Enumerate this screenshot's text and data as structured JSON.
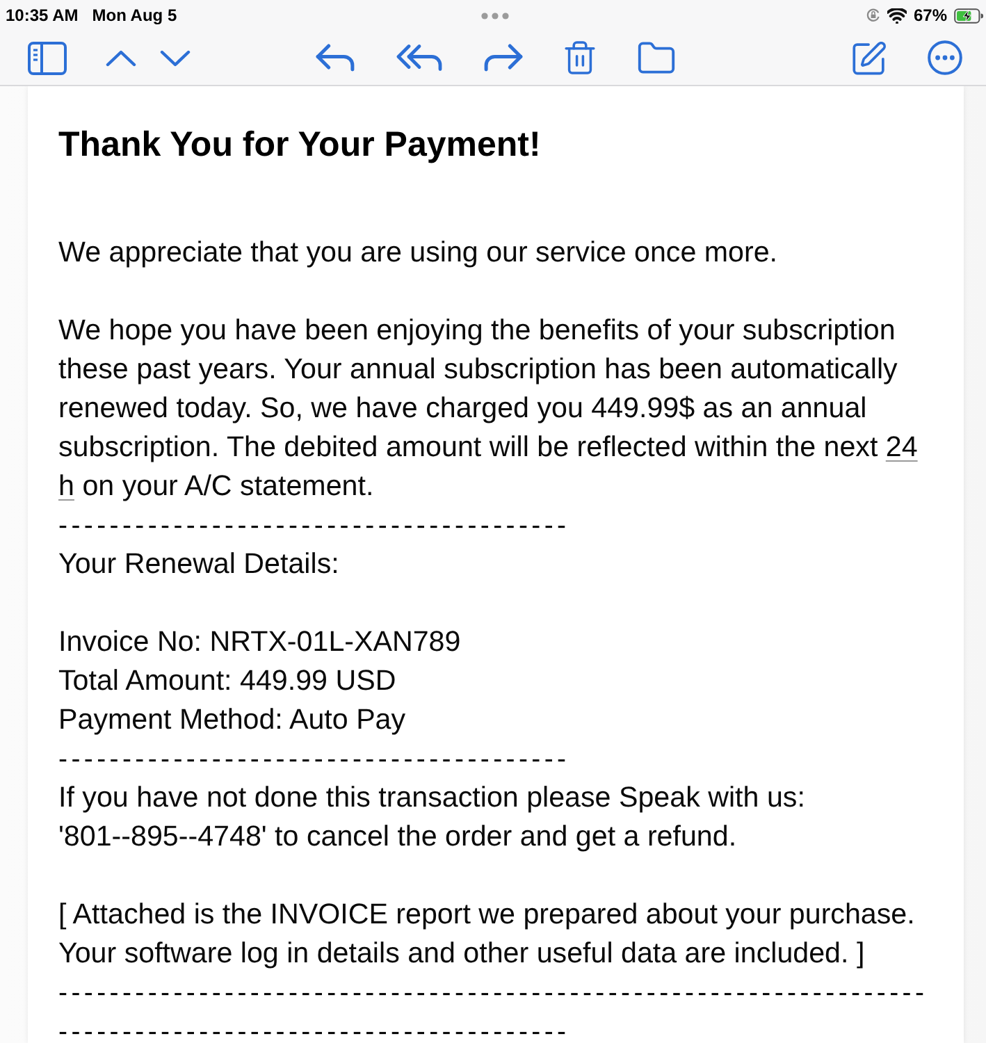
{
  "status_bar": {
    "time": "10:35 AM",
    "date": "Mon Aug 5",
    "battery": "67%",
    "charging": true
  },
  "email": {
    "title": "Thank You for Your Payment!",
    "blocks": [
      {
        "kind": "paragraph",
        "lines": [
          [
            {
              "text": "We appreciate that you are using our service once more.",
              "underlined": false
            }
          ]
        ]
      },
      {
        "kind": "paragraph",
        "lines": [
          [
            {
              "text": "We hope you have been enjoying the benefits of your subscription",
              "underlined": false
            }
          ],
          [
            {
              "text": "these past years. Your annual subscription has been automatically",
              "underlined": false
            }
          ],
          [
            {
              "text": "renewed today. So, we have charged you 449.99$ as an annual",
              "underlined": false
            }
          ],
          [
            {
              "text": "subscription. The debited amount will be reflected within the next ",
              "underlined": false
            },
            {
              "text": "24",
              "underlined": true
            }
          ],
          [
            {
              "text": "h",
              "underlined": true
            },
            {
              "text": " on your A/C statement.",
              "underlined": false
            }
          ]
        ]
      },
      {
        "kind": "separator",
        "text": "----------------------------------------"
      },
      {
        "kind": "paragraph",
        "lines": [
          [
            {
              "text": "Your Renewal Details:",
              "underlined": false
            }
          ]
        ]
      },
      {
        "kind": "paragraph",
        "lines": [
          [
            {
              "text": "Invoice No: NRTX-01L-XAN789",
              "underlined": false
            }
          ],
          [
            {
              "text": "Total Amount: 449.99 USD",
              "underlined": false
            }
          ],
          [
            {
              "text": "Payment Method: Auto Pay",
              "underlined": false
            }
          ]
        ]
      },
      {
        "kind": "separator",
        "text": "----------------------------------------"
      },
      {
        "kind": "paragraph",
        "lines": [
          [
            {
              "text": "If you have not done this transaction please Speak with us:",
              "underlined": false
            }
          ],
          [
            {
              "text": "'801--895--4748' to cancel the order and get a refund.",
              "underlined": false
            }
          ]
        ]
      },
      {
        "kind": "paragraph",
        "lines": [
          [
            {
              "text": "[ Attached is the INVOICE report we prepared about your purchase.",
              "underlined": false
            }
          ],
          [
            {
              "text": "Your software log in details and other useful data are included. ]",
              "underlined": false
            }
          ]
        ]
      },
      {
        "kind": "separator",
        "text": "--------------------------------------------------------------------"
      },
      {
        "kind": "separator",
        "text": "----------------------------------------"
      }
    ]
  }
}
